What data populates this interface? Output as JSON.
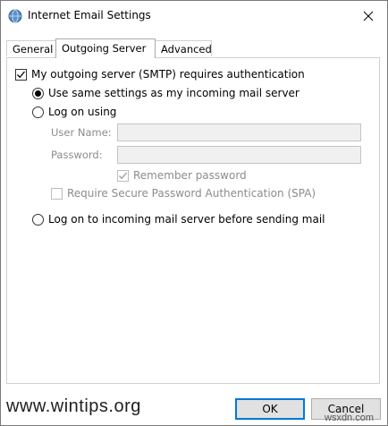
{
  "window": {
    "title": "Internet Email Settings"
  },
  "tabs": [
    {
      "label": "General",
      "active": false
    },
    {
      "label": "Outgoing Server",
      "active": true
    },
    {
      "label": "Advanced",
      "active": false
    }
  ],
  "options": {
    "requires_auth": {
      "label": "My outgoing server (SMTP) requires authentication",
      "checked": true
    },
    "same_settings": {
      "label": "Use same settings as my incoming mail server",
      "selected": true
    },
    "log_on_using": {
      "label": "Log on using",
      "selected": false
    },
    "user_name_label": "User Name:",
    "user_name_value": "",
    "password_label": "Password:",
    "password_value": "",
    "remember_password": {
      "label": "Remember password",
      "checked": true,
      "enabled": false
    },
    "require_spa": {
      "label": "Require Secure Password Authentication (SPA)",
      "checked": false,
      "enabled": false
    },
    "log_on_incoming": {
      "label": "Log on to incoming mail server before sending mail",
      "selected": false
    }
  },
  "buttons": {
    "ok": "OK",
    "cancel": "Cancel"
  },
  "watermark": {
    "left": "www.wintips.org",
    "right": "wsxdn.com"
  },
  "colors": {
    "default_button_border": "#0078d7",
    "disabled_text": "#8c8c8c"
  }
}
